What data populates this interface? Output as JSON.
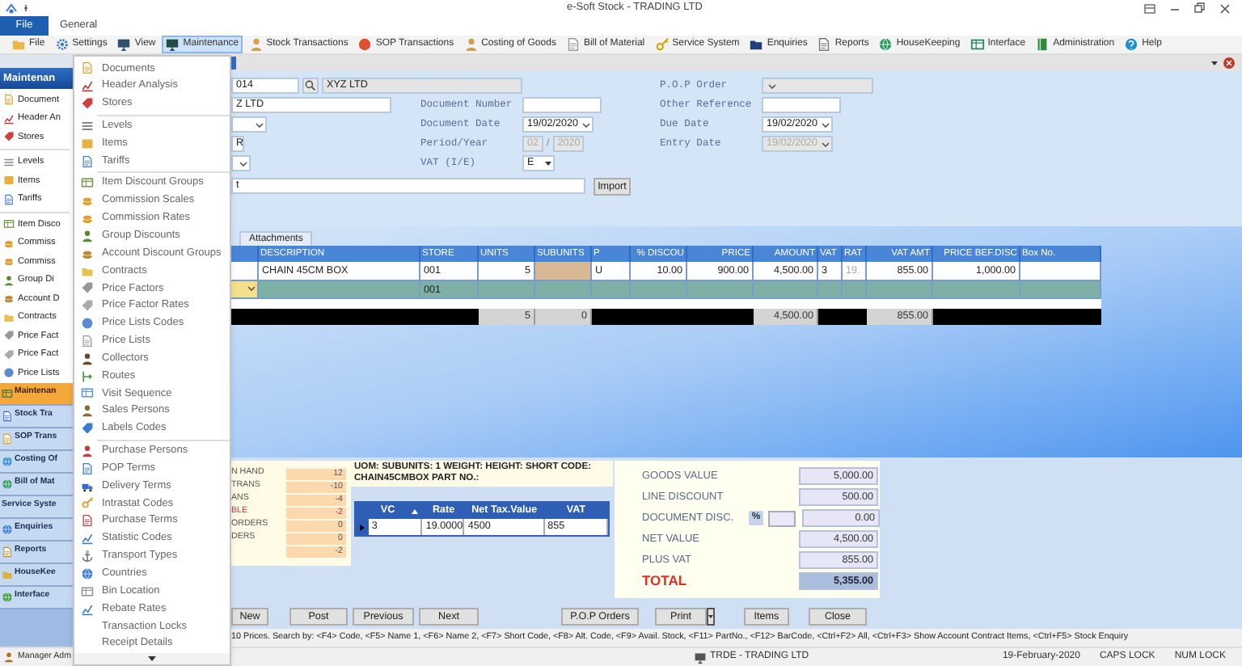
{
  "window": {
    "title": "e-Soft Stock - TRADING LTD"
  },
  "ribbon_tabs": [
    {
      "label": "File",
      "selected": true
    },
    {
      "label": "General",
      "selected": false
    }
  ],
  "menu_bar": [
    {
      "label": "File",
      "selected": false
    },
    {
      "label": "Settings",
      "selected": false
    },
    {
      "label": "View",
      "selected": false
    },
    {
      "label": "Maintenance",
      "selected": true
    },
    {
      "label": "Stock Transactions",
      "selected": false
    },
    {
      "label": "SOP Transactions",
      "selected": false
    },
    {
      "label": "Costing of Goods",
      "selected": false
    },
    {
      "label": "Bill of Material",
      "selected": false
    },
    {
      "label": "Service System",
      "selected": false
    },
    {
      "label": "Enquiries",
      "selected": false
    },
    {
      "label": "Reports",
      "selected": false
    },
    {
      "label": "HouseKeeping",
      "selected": false
    },
    {
      "label": "Interface",
      "selected": false
    },
    {
      "label": "Administration",
      "selected": false
    },
    {
      "label": "Help",
      "selected": false
    }
  ],
  "sidebar": {
    "title": "Maintenan",
    "groups": [
      [
        "Document",
        "Header An",
        "Stores"
      ],
      [
        "Levels",
        "Items",
        "Tariffs"
      ],
      [
        "Item Disco",
        "Commiss",
        "Commiss",
        "Group Di",
        "Account D",
        "Contracts",
        "Price Fact",
        "Price Fact",
        "Price Lists"
      ]
    ],
    "sections": [
      {
        "label": "Maintenan",
        "selected": true
      },
      {
        "label": "Stock Tra",
        "selected": false
      },
      {
        "label": "SOP Trans",
        "selected": false
      },
      {
        "label": "Costing Of",
        "selected": false
      },
      {
        "label": "Bill of Mat",
        "selected": false
      },
      {
        "label": "Service Syste",
        "selected": false
      },
      {
        "label": "Enquiries",
        "selected": false
      },
      {
        "label": "Reports",
        "selected": false
      },
      {
        "label": "HouseKee",
        "selected": false
      },
      {
        "label": "Interface",
        "selected": false
      }
    ],
    "user": "Manager Adm"
  },
  "dropdown_menu": {
    "groups": [
      [
        "Documents",
        "Header Analysis",
        "Stores"
      ],
      [
        "Levels",
        "Items",
        "Tariffs"
      ],
      [
        "Item Discount Groups",
        "Commission Scales",
        "Commission Rates",
        "Group Discounts",
        "Account Discount Groups",
        "Contracts",
        "Price Factors",
        "Price Factor Rates",
        "Price Lists Codes",
        "Price Lists",
        "Collectors",
        "Routes",
        "Visit Sequence",
        "Sales Persons",
        "Labels Codes"
      ],
      [
        "Purchase Persons",
        "POP Terms",
        "Delivery Terms",
        "Intrastat Codes",
        "Purchase Terms",
        "Statistic Codes",
        "Transport Types",
        "Countries",
        "Bin Location",
        "Rebate Rates",
        "Transaction Locks",
        "Receipt Details"
      ]
    ]
  },
  "form": {
    "account_code": "014",
    "account_name": "XYZ LTD",
    "address": "Z LTD",
    "field": "R",
    "line": "t",
    "import_button": "Import",
    "middle": [
      {
        "label": "Document Number",
        "kind": "text",
        "disabled": false
      },
      {
        "label": "Document Date",
        "kind": "date",
        "value": "19/02/2020",
        "disabled": false
      },
      {
        "label": "Period/Year",
        "kind": "period",
        "value": "02",
        "year": "2020",
        "separator": "/",
        "disabled": true
      },
      {
        "label": "VAT (I/E)",
        "kind": "combo",
        "value": "E",
        "disabled": false
      }
    ],
    "right": [
      {
        "label": "P.O.P Order",
        "kind": "combo",
        "disabled": true
      },
      {
        "label": "Other Reference",
        "kind": "text",
        "disabled": false
      },
      {
        "label": "Due Date",
        "kind": "date",
        "value": "19/02/2020",
        "disabled": false
      },
      {
        "label": "Entry Date",
        "kind": "date",
        "value": "19/02/2020",
        "disabled": true
      }
    ]
  },
  "tabs": [
    {
      "label": "Attachments",
      "selected": false
    }
  ],
  "table": {
    "columns": [
      "DESCRIPTION",
      "STORE",
      "UNITS",
      "SUBUNITS",
      "P",
      "% DISCOU",
      "PRICE",
      "AMOUNT",
      "VAT",
      "RAT",
      "VAT AMT",
      "PRICE BEF.DISC",
      "Box No."
    ],
    "rows": [
      {
        "selected": false,
        "description": "CHAIN 45CM BOX",
        "store": "001",
        "units": "5",
        "p": "U",
        "discount": "10.00",
        "price": "900.00",
        "amount": "4,500.00",
        "vat": "3",
        "rate": "19.",
        "vat_amt": "855.00",
        "price_bef_disc": "1,000.00"
      },
      {
        "selected": true,
        "store": "001"
      }
    ],
    "totals": {
      "units": "5",
      "subunits": "0",
      "amount": "4,500.00",
      "vat_amt": "855.00"
    }
  },
  "stock": [
    {
      "label": "N HAND",
      "value": "12",
      "alert": false
    },
    {
      "label": "TRANS",
      "value": "-10",
      "alert": false
    },
    {
      "label": "ANS",
      "value": "-4",
      "alert": false
    },
    {
      "label": "BLE",
      "value": "-2",
      "alert": true
    },
    {
      "label": "ORDERS",
      "value": "0",
      "alert": false
    },
    {
      "label": "DERS",
      "value": "0",
      "alert": false
    },
    {
      "value": "-2",
      "alert": false
    }
  ],
  "uom_text": "UOM:   SUBUNITS: 1 WEIGHT:   HEIGHT:   SHORT CODE: CHAIN45CMBOX PART NO.:",
  "vat_table": {
    "columns": [
      "VC",
      "Rate",
      "Net Tax.Value",
      "VAT"
    ],
    "rows": [
      [
        "3",
        "19.0000",
        "4500",
        "855"
      ]
    ]
  },
  "totals": [
    {
      "label": "GOODS VALUE",
      "value": "5,000.00",
      "kind": "plain"
    },
    {
      "label": "LINE DISCOUNT",
      "value": "500.00",
      "kind": "plain"
    },
    {
      "label": "DOCUMENT DISC.",
      "value": "0.00",
      "kind": "discount",
      "percent": "%"
    },
    {
      "label": "NET VALUE",
      "value": "4,500.00",
      "kind": "plain"
    },
    {
      "label": "PLUS VAT",
      "value": "855.00",
      "kind": "plain"
    },
    {
      "label": "TOTAL",
      "value": "5,355.00",
      "kind": "total"
    }
  ],
  "buttons": [
    {
      "label": "New",
      "kind": "plain"
    },
    {
      "label": "Post",
      "kind": "plain"
    },
    {
      "label": "Previous",
      "kind": "plain"
    },
    {
      "label": "Next",
      "kind": "plain"
    },
    {
      "label": "P.O.P Orders",
      "kind": "plain"
    },
    {
      "label": "Print",
      "kind": "split"
    },
    {
      "label": "Items",
      "kind": "plain"
    },
    {
      "label": "Close",
      "kind": "plain"
    }
  ],
  "hint": "10 Prices. Search by: <F4> Code, <F5> Name 1, <F6> Name 2, <F7> Short Code, <F8> Alt. Code, <F9> Avail. Stock, <F11> PartNo., <F12> BarCode, <Ctrl+F2> All, <Ctrl+F3> Show Account Contract Items, <Ctrl+F5> Stock Enquiry",
  "status_bar": {
    "company": "TRDE - TRADING LTD",
    "date": "19-February-2020",
    "caps_lock": "CAPS LOCK",
    "num_lock": "NUM LOCK"
  }
}
